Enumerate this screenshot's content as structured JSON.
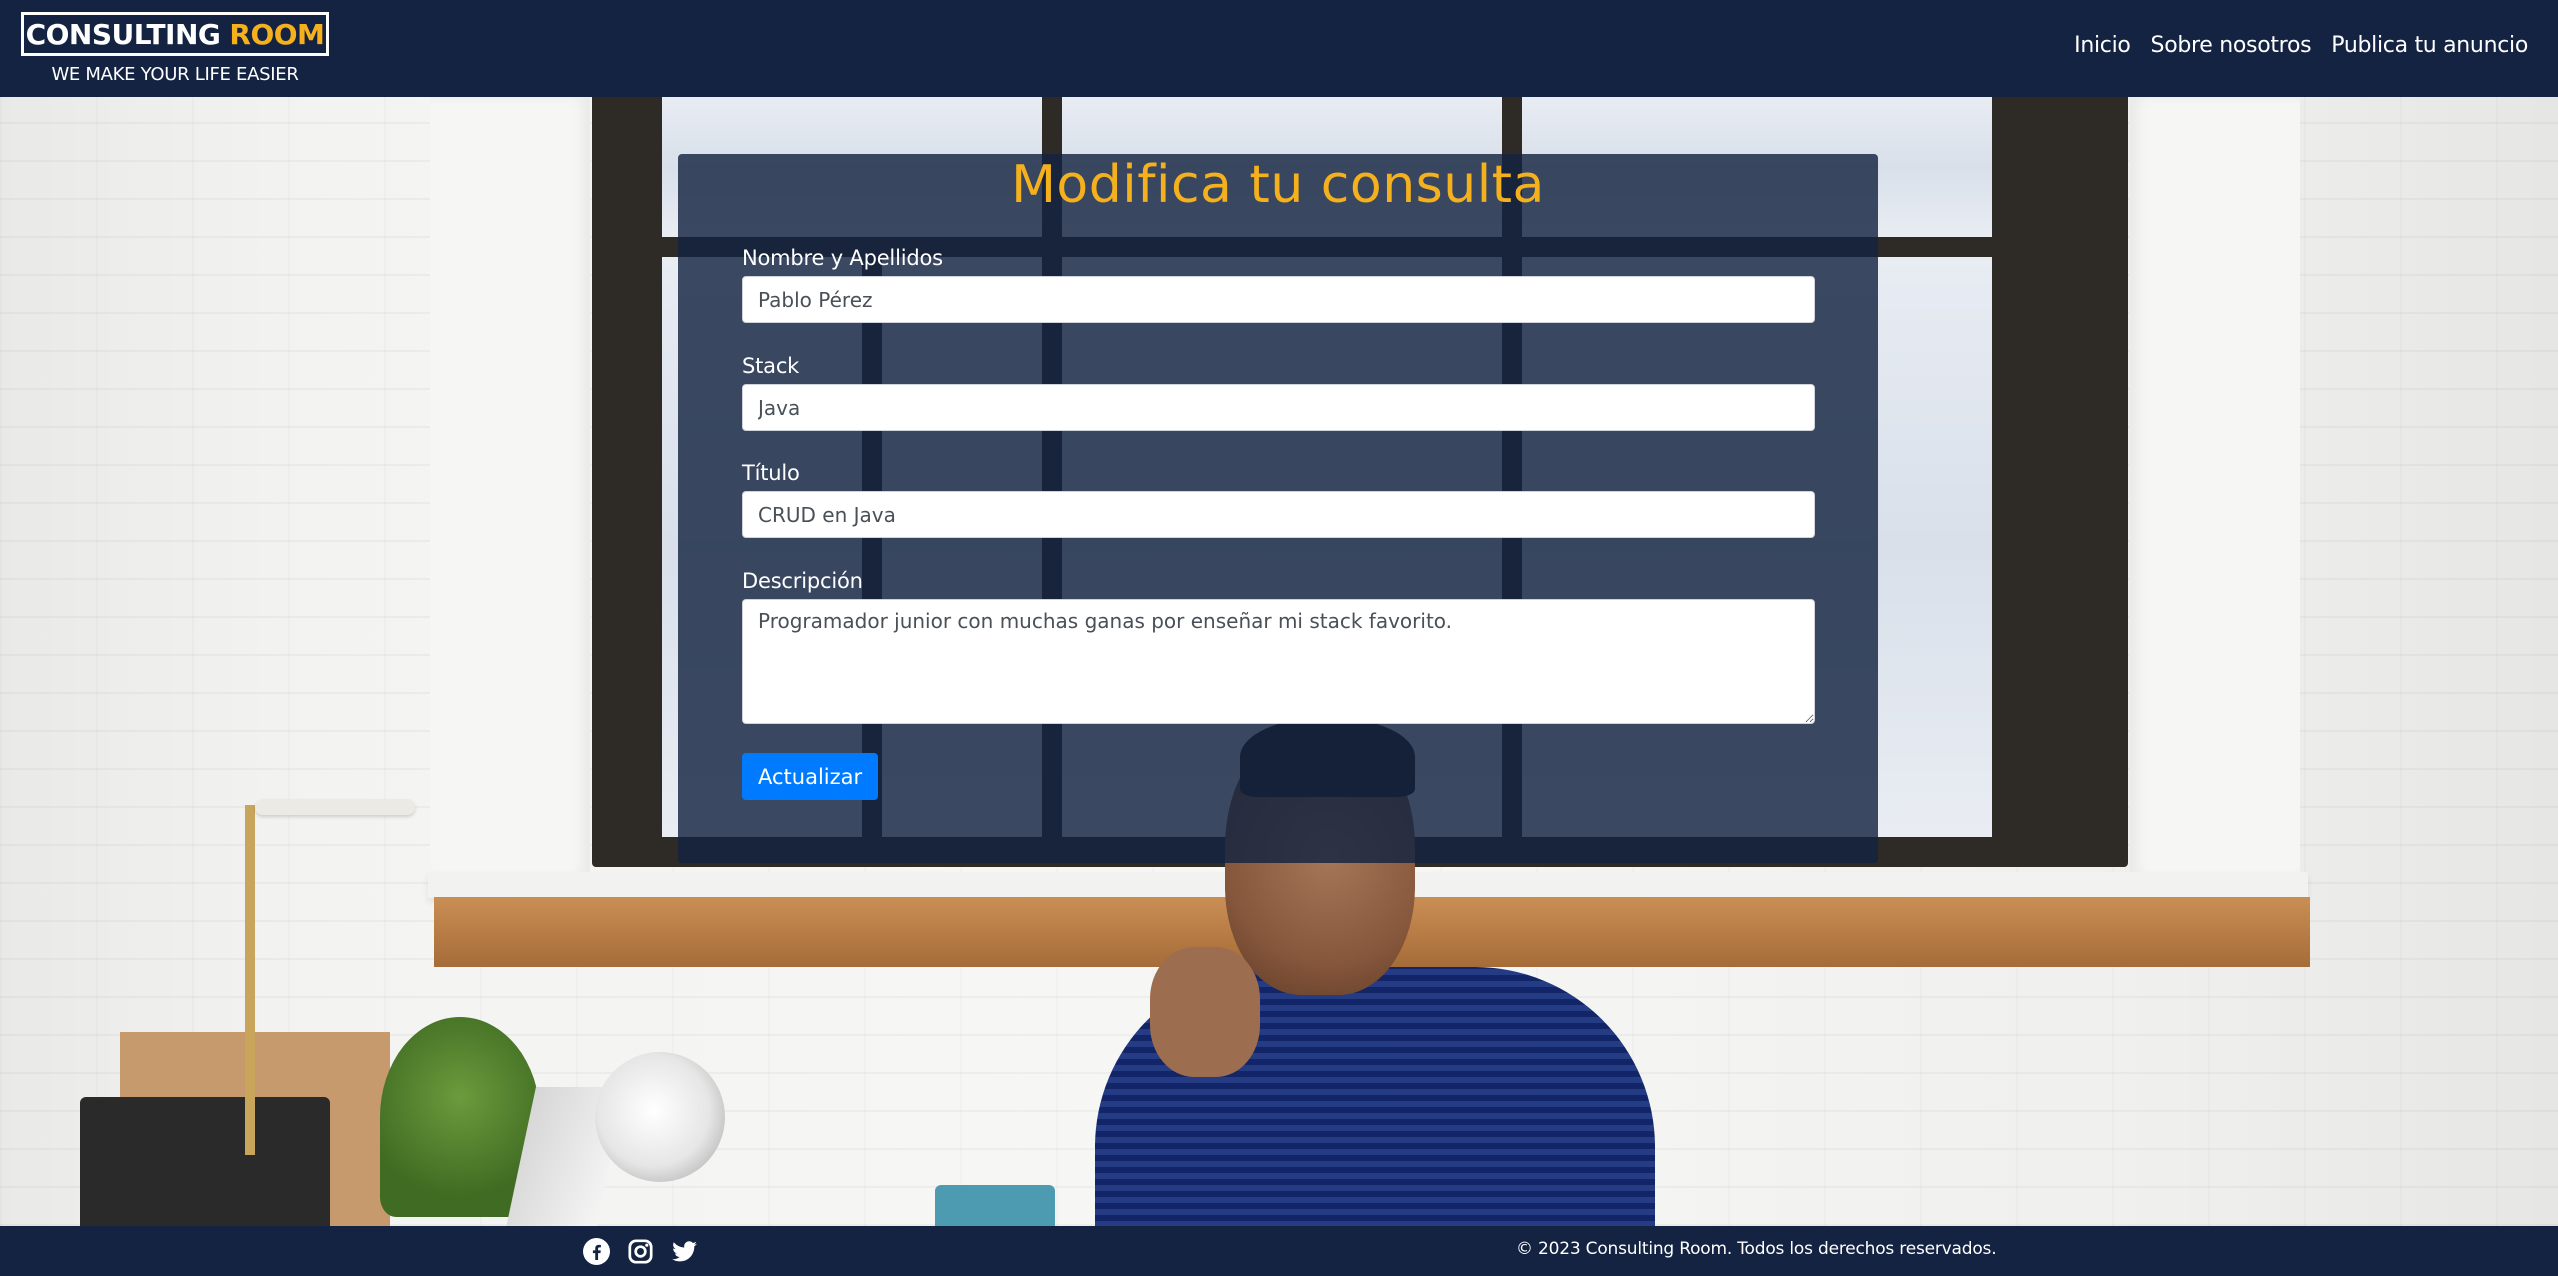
{
  "header": {
    "logo_part1": "CONSULTING",
    "logo_part2": "ROOM",
    "tagline": "WE MAKE YOUR LIFE EASIER",
    "nav": [
      {
        "label": "Inicio"
      },
      {
        "label": "Sobre nosotros"
      },
      {
        "label": "Publica tu anuncio"
      }
    ]
  },
  "form": {
    "title": "Modifica tu consulta",
    "fields": {
      "name": {
        "label": "Nombre y Apellidos",
        "value": "Pablo Pérez"
      },
      "stack": {
        "label": "Stack",
        "value": "Java"
      },
      "title": {
        "label": "Título",
        "value": "CRUD en Java"
      },
      "description": {
        "label": "Descripción",
        "value": "Programador junior con muchas ganas por enseñar mi stack favorito."
      }
    },
    "submit_label": "Actualizar"
  },
  "footer": {
    "social_icons": [
      "facebook-icon",
      "instagram-icon",
      "twitter-icon"
    ],
    "copyright": "© 2023 Consulting Room. Todos los derechos reservados."
  },
  "colors": {
    "navy": "#142341",
    "accent": "#f5b01e",
    "button": "#007bff"
  }
}
